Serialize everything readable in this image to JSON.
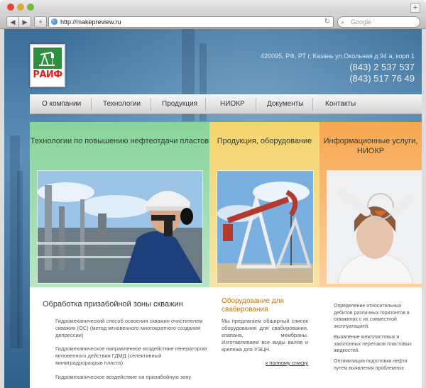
{
  "browser": {
    "url": "http://makepreview.ru",
    "search_placeholder": "Google"
  },
  "header": {
    "logo_text": "РАИФ",
    "address": "420095, РФ, РТ г. Казань ул.Окольная д 94 а, корп 1",
    "phone1": "(843) 2 537 537",
    "phone2": "(843) 517 76 49"
  },
  "menu": [
    "О компании",
    "Технологии",
    "Продукция",
    "НИОКР",
    "Документы",
    "Контакты"
  ],
  "panels": {
    "p1_title": "Технологии по повышению нефтеотдачи пластов",
    "p2_title": "Продукция, оборудование",
    "p3_title": "Информационные услуги, НИОКР"
  },
  "content": {
    "c1_title": "Обработка призабойной зоны скважин",
    "c1_items": [
      "Гидромеханический способ освоения скважин очистителем скважин (ОС) (метод мгновенного многократного создания депрессии)",
      "Гидромеханическое направленное воздействие генератором мгновенного действия ГДМД (селективный миниградроразрыв пласта)",
      "Гидромеханическое воздействие на призабойную зону"
    ],
    "c2_title": "Оборудование для свабирования",
    "c2_text": "Мы предлагаем обширный список оборудования для свабирования, клапана, мембраны. Изготавливаем все виды валов и крепежа для УЭЦН.",
    "c2_link": "к полному списку",
    "c3_items": [
      "Определение относительных дебитов различных горизонтов в скважинах с их совместной эксплуатацией.",
      "Выявление межпластовых и заколонных перетоков пластовых жидкостей.",
      "Оптимизация подготовки нефти путем выявления проблемных"
    ]
  }
}
